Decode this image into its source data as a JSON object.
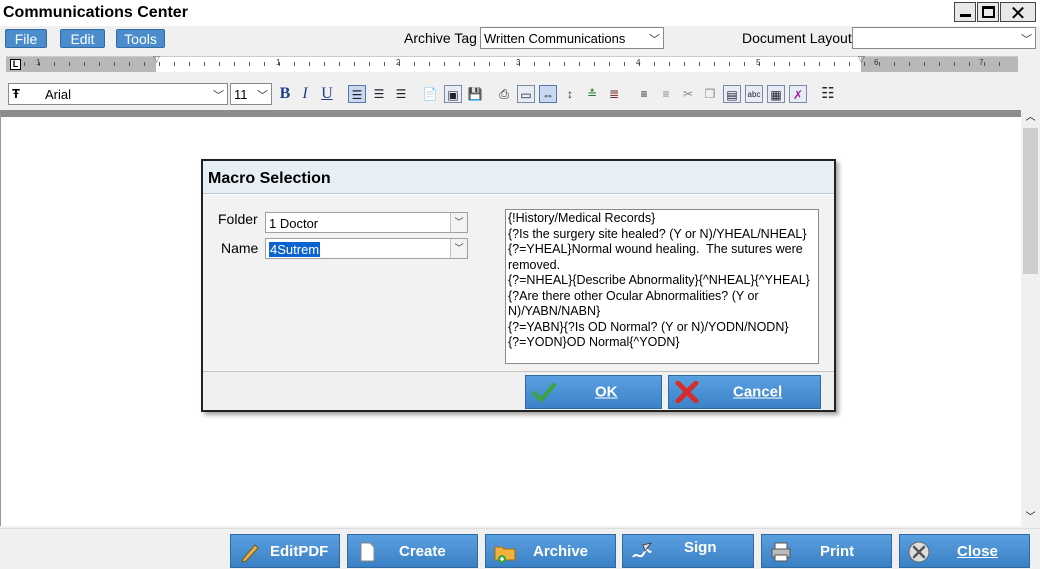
{
  "window": {
    "title": "Communications Center",
    "controls": {
      "minimize": "minimize-icon",
      "maximize": "maximize-icon",
      "close": "close-icon"
    }
  },
  "menu": {
    "items": [
      {
        "label": "File"
      },
      {
        "label": "Edit"
      },
      {
        "label": "Tools"
      }
    ],
    "archive_tag_label": "Archive Tag",
    "archive_tag_value": "Written Communications",
    "document_layout_label": "Document Layout",
    "document_layout_value": ""
  },
  "ruler": {
    "numbers": [
      "1",
      "1",
      "2",
      "3",
      "4",
      "5",
      "6",
      "7"
    ]
  },
  "format_toolbar": {
    "font_name": "Arial",
    "font_size": "11",
    "bold": "B",
    "italic": "I",
    "underline": "U"
  },
  "dialog": {
    "title": "Macro Selection",
    "folder_label": "Folder",
    "folder_value": "1 Doctor",
    "name_label": "Name",
    "name_value": "4Sutrem",
    "macro_text": "{!History/Medical Records}\n{?Is the surgery site healed? (Y or N)/YHEAL/NHEAL}{?=YHEAL}Normal wound healing.  The sutures were removed.\n{?=NHEAL}{Describe Abnormality}{^NHEAL}{^YHEAL}\n{?Are there other Ocular Abnormalities? (Y or N)/YABN/NABN}\n{?=YABN}{?Is OD Normal? (Y or N)/YODN/NODN}\n{?=YODN}OD Normal{^YODN}",
    "ok_label": "OK",
    "cancel_label": "Cancel"
  },
  "bottom_bar": {
    "buttons": [
      {
        "label": "EditPDF",
        "icon": "pencil-icon"
      },
      {
        "label": "Create",
        "icon": "new-document-icon"
      },
      {
        "label": "Archive",
        "icon": "folder-add-icon"
      },
      {
        "label": "Sign",
        "icon": "signature-icon"
      },
      {
        "label": "Print",
        "icon": "printer-icon"
      },
      {
        "label": "Close",
        "icon": "close-circle-icon"
      }
    ]
  },
  "colors": {
    "accent_blue": "#4a8ccc",
    "ok_check": "#3aa53a",
    "cancel_x": "#d62c2c",
    "selection": "#0a64d0"
  }
}
